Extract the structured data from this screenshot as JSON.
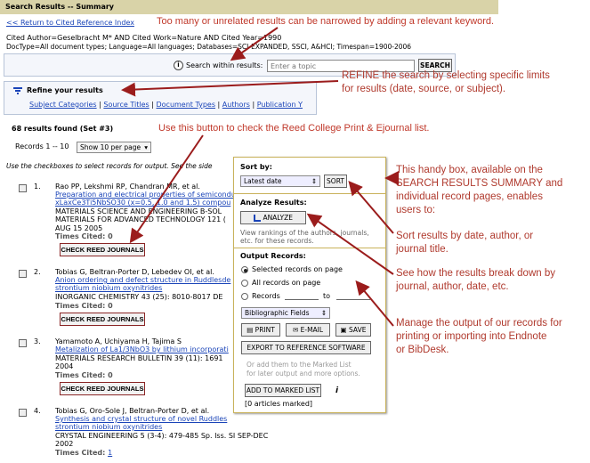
{
  "header": {
    "title": "Search Results -- Summary"
  },
  "back_link": "<< Return to Cited Reference Index",
  "query_line1": "Cited Author=Geselbracht M* AND Cited Work=Nature AND Cited Year=1990",
  "query_line2": "DocType=All document types; Language=All languages; Databases=SCI-EXPANDED, SSCI, A&HCI; Timespan=1900-2006",
  "search_within": {
    "label": "Search within results:",
    "placeholder": "Enter a topic",
    "button": "SEARCH",
    "info_icon": "info-icon"
  },
  "refine": {
    "title": "Refine your results",
    "links": [
      "Subject Categories",
      "Source Titles",
      "Document Types",
      "Authors",
      "Publication Y"
    ]
  },
  "results_found": "68 results found (Set #3)",
  "records_label": "Records 1 -- 10",
  "per_page": "Show 10 per page",
  "checkbox_hint": "Use the checkboxes to select records for output. See the side",
  "check_button_label": "CHECK REED JOURNALS",
  "records": [
    {
      "num": "1.",
      "authors": "Rao PP, Lekshmi RP, Chandran MR, et al.",
      "title1": "Preparation and electrical properties of semicondu",
      "title2": "xLaxCe3Ti5NbSO30 (x=0.5, 1.0 and 1.5) compou",
      "source1": "MATERIALS SCIENCE AND ENGINEERING B-SOL",
      "source2": "MATERIALS FOR ADVANCED TECHNOLOGY 121 (",
      "source3": "AUG 15 2005",
      "cited": "Times Cited: 0"
    },
    {
      "num": "2.",
      "authors": "Tobias G, Beltran-Porter D, Lebedev OI, et al.",
      "title1": "Anion ordering and defect structure in Ruddlesde",
      "title2": "strontium niobium oxynitrides",
      "source1": "INORGANIC CHEMISTRY 43 (25): 8010-8017 DE",
      "source2": "",
      "source3": "",
      "cited": "Times Cited: 0"
    },
    {
      "num": "3.",
      "authors": "Yamamoto A, Uchiyama H, Tajima S",
      "title1": "Metalization of La1/3NbO3 by lithium incorporati",
      "title2": "",
      "source1": "MATERIALS RESEARCH BULLETIN 39 (11): 1691",
      "source2": "2004",
      "source3": "",
      "cited": "Times Cited: 0"
    },
    {
      "num": "4.",
      "authors": "Tobias G, Oro-Sole J, Beltran-Porter D, et al.",
      "title1": "Synthesis and crystal structure of novel Ruddles",
      "title2": "strontium niobium oxynitrides",
      "source1": "CRYSTAL ENGINEERING 5 (3-4): 479-485 Sp. Iss. SI SEP-DEC",
      "source2": "2002",
      "source3": "",
      "cited_label": "Times Cited:",
      "cited_value": "1"
    }
  ],
  "sidebox": {
    "sort_title": "Sort by:",
    "sort_value": "Latest date",
    "sort_button": "SORT",
    "analyze_title": "Analyze Results:",
    "analyze_button": "ANALYZE",
    "analyze_desc": "View rankings of the authors, journals, etc. for these records.",
    "output_title": "Output Records:",
    "opt1": "Selected records on page",
    "opt2": "All records on page",
    "opt3": "Records",
    "opt3_to": "to",
    "fields_select": "Bibliographic Fields",
    "print": "PRINT",
    "email": "E-MAIL",
    "save": "SAVE",
    "export": "EXPORT TO REFERENCE SOFTWARE",
    "marked_desc1": "Or add them to the Marked List",
    "marked_desc2": "for later output and more options.",
    "add_marked": "ADD TO MARKED LIST",
    "marked_count": "[0 articles marked]"
  },
  "annotations": {
    "keyword": "Too many or unrelated results can be narrowed by adding a relevant keyword.",
    "refine1": "REFINE the search by selecting specific limits",
    "refine2": "for results (date, source, or subject).",
    "reed": "Use this button to check the Reed College Print & Ejournal list.",
    "box1": "This handy box, available on the",
    "box2": "SEARCH RESULTS SUMMARY and",
    "box3": "individual record pages, enables",
    "box4": "users to:",
    "sort1": "Sort results by date, author, or",
    "sort2": "journal title.",
    "analyze1": "See how the results break down by",
    "analyze2": "journal, author, date, etc.",
    "manage1": "Manage the output of our records for",
    "manage2": "printing or importing into Endnote",
    "manage3": "or BibDesk."
  },
  "colors": {
    "annotation": "#c0392b",
    "link": "#1a44b8",
    "header_bg": "#d9d3a8"
  }
}
